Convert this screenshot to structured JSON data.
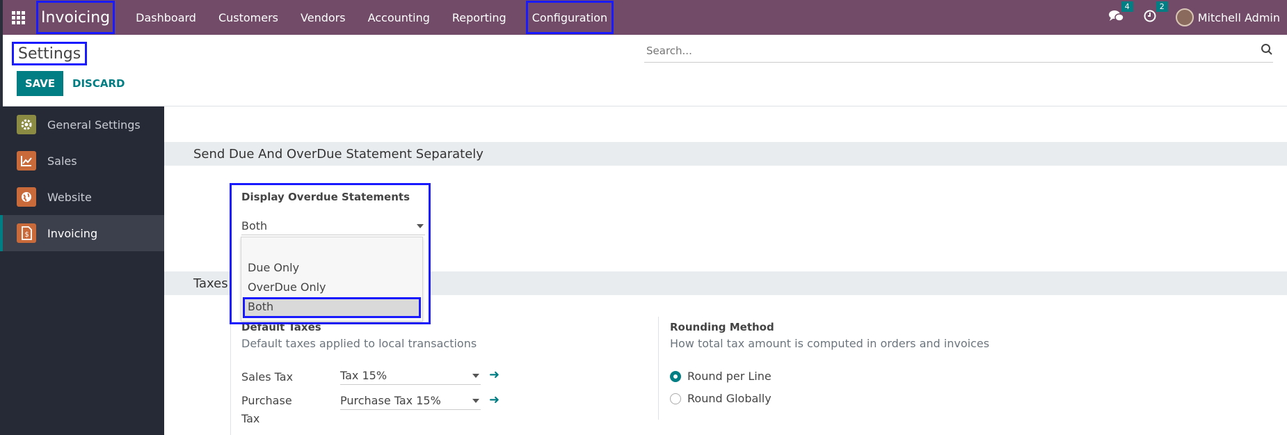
{
  "navbar": {
    "app_name": "Invoicing",
    "menu": [
      "Dashboard",
      "Customers",
      "Vendors",
      "Accounting",
      "Reporting",
      "Configuration"
    ],
    "messages_badge": "4",
    "activities_badge": "2",
    "user_name": "Mitchell Admin"
  },
  "control_panel": {
    "title": "Settings",
    "search_placeholder": "Search...",
    "save_label": "SAVE",
    "discard_label": "DISCARD"
  },
  "sidebar": {
    "items": [
      {
        "label": "General Settings",
        "icon": "gear-icon",
        "color": "#8b8b43"
      },
      {
        "label": "Sales",
        "icon": "chart-icon",
        "color": "#c96a3b"
      },
      {
        "label": "Website",
        "icon": "globe-icon",
        "color": "#c96a3b"
      },
      {
        "label": "Invoicing",
        "icon": "invoice-icon",
        "color": "#c96a3b"
      }
    ]
  },
  "statement_section": {
    "heading": "Send Due And OverDue Statement Separately",
    "setting_title": "Display Overdue Statements",
    "selected_value": "Both",
    "options": [
      "",
      "Due Only",
      "OverDue Only",
      "Both"
    ]
  },
  "taxes_section": {
    "heading": "Taxes",
    "default_taxes": {
      "title": "Default Taxes",
      "help": "Default taxes applied to local transactions",
      "sales_tax_label": "Sales Tax",
      "sales_tax_value": "Tax 15%",
      "purchase_tax_label_line1": "Purchase",
      "purchase_tax_label_line2": "Tax",
      "purchase_tax_value": "Purchase Tax 15%"
    },
    "rounding": {
      "title": "Rounding Method",
      "help": "How total tax amount is computed in orders and invoices",
      "options": [
        "Round per Line",
        "Round Globally"
      ],
      "selected": "Round per Line"
    }
  },
  "colors": {
    "navbar": "#714b67",
    "accent": "#017e84",
    "highlight_box": "#1a1aff"
  }
}
